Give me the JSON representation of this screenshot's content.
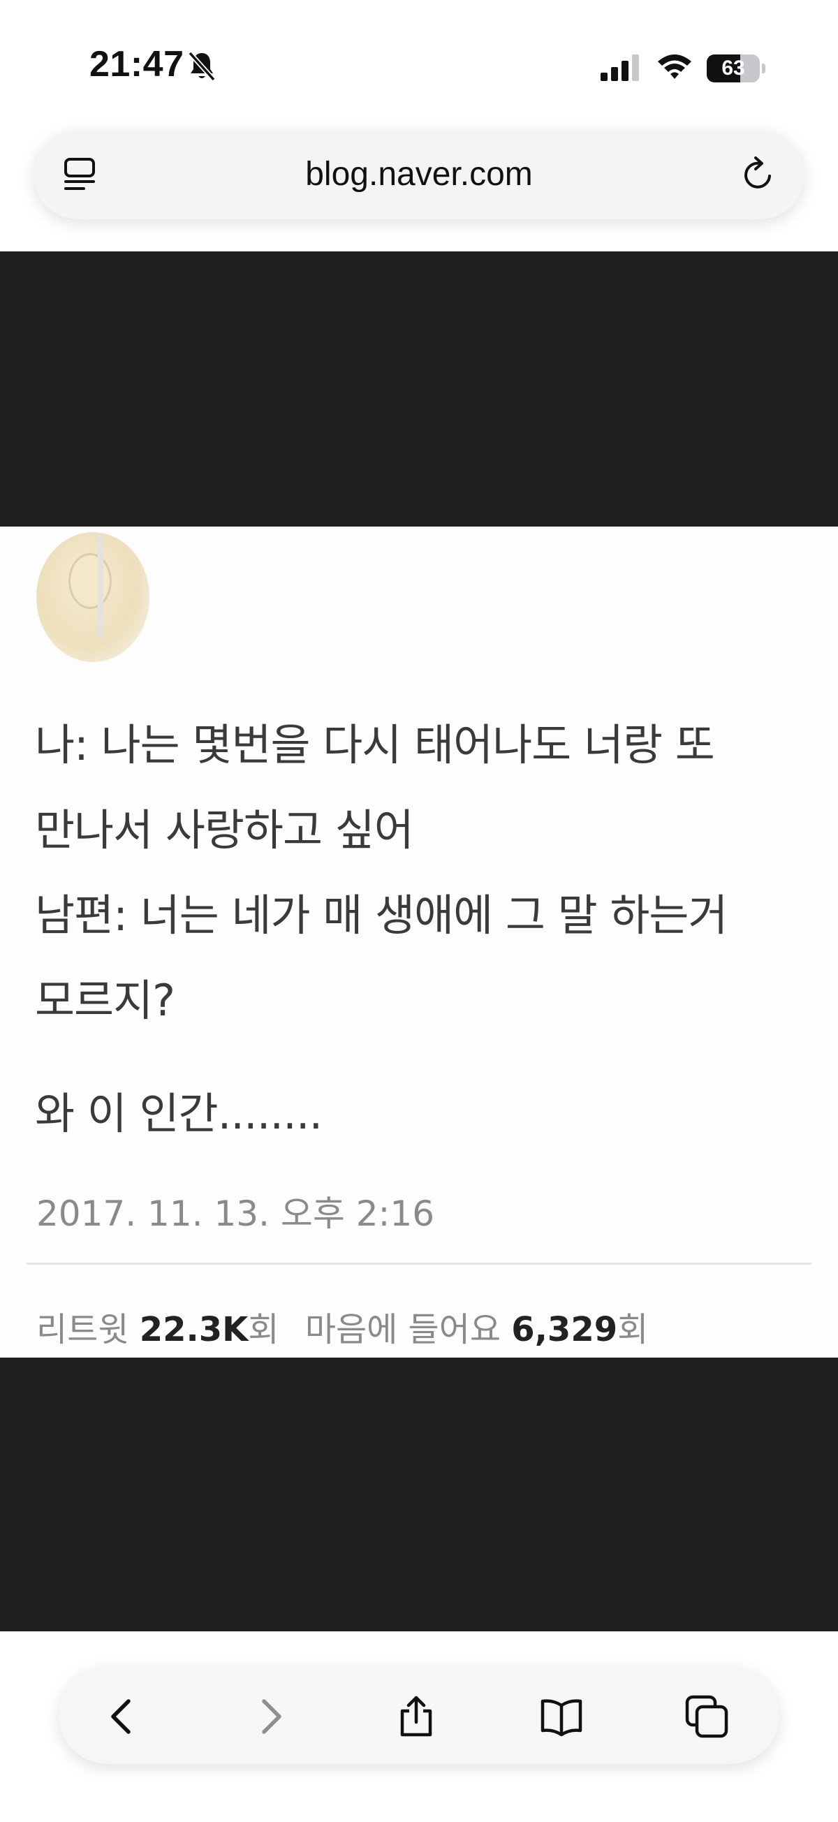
{
  "status_bar": {
    "time": "21:47",
    "battery_level": "63",
    "icons": [
      "bell-slash-icon",
      "cellular-signal-icon",
      "wifi-icon",
      "battery-icon"
    ]
  },
  "browser": {
    "url": "blog.naver.com",
    "icons": [
      "reader-mode-icon",
      "reload-icon"
    ]
  },
  "tweet": {
    "lines": [
      "나: 나는 몇번을 다시 태어나도 너랑 또",
      "만나서 사랑하고 싶어",
      "남편: 너는 네가 매 생애에 그 말 하는거",
      "모르지?",
      "와 이 인간........"
    ],
    "date": "2017. 11. 13. 오후 2:16",
    "stats": {
      "retweet_label": "리트윗",
      "retweet_count": "22.3K",
      "retweet_unit": "회",
      "like_label": "마음에 들어요",
      "like_count": "6,329",
      "like_unit": "회"
    }
  },
  "toolbar": {
    "icons": [
      "back-icon",
      "forward-icon",
      "share-icon",
      "bookmarks-icon",
      "tabs-icon"
    ]
  },
  "colors": {
    "dark_band": "#1e1e1f",
    "text_primary": "#3a3a3a",
    "text_secondary": "#8a8a8a"
  }
}
